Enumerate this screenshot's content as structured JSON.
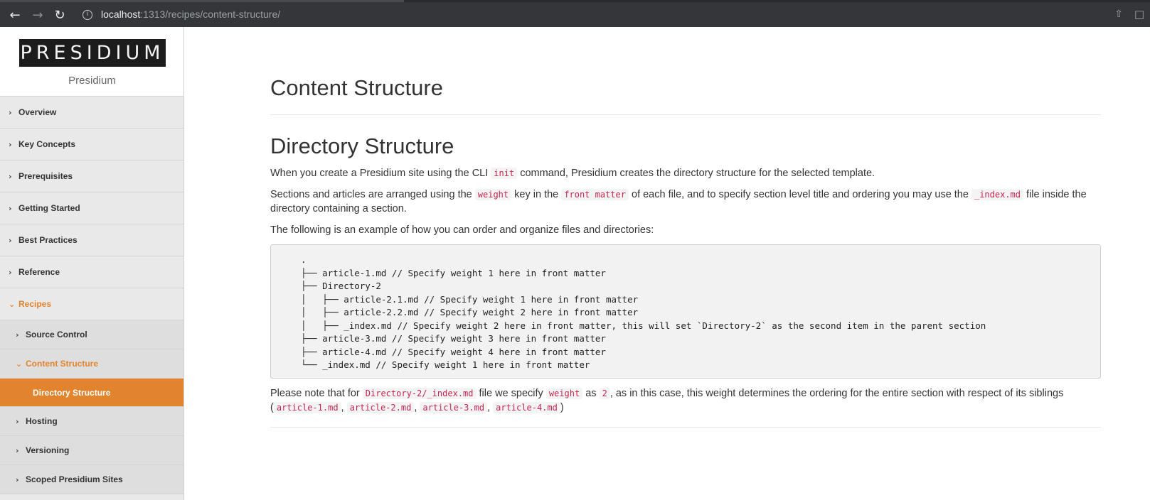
{
  "browser": {
    "url_host": "localhost",
    "url_path": ":1313/recipes/content-structure/",
    "back_icon": "arrow-left-icon",
    "forward_icon": "arrow-right-icon",
    "reload_icon": "reload-icon"
  },
  "sidebar": {
    "logo_text": "PRESIDIUM",
    "site_name": "Presidium",
    "menu": [
      {
        "label": "Overview"
      },
      {
        "label": "Key Concepts"
      },
      {
        "label": "Prerequisites"
      },
      {
        "label": "Getting Started"
      },
      {
        "label": "Best Practices"
      },
      {
        "label": "Reference"
      },
      {
        "label": "Recipes"
      }
    ],
    "submenu": [
      {
        "label": "Source Control"
      },
      {
        "label": "Content Structure"
      },
      {
        "label": "Hosting"
      },
      {
        "label": "Versioning"
      },
      {
        "label": "Scoped Presidium Sites"
      }
    ],
    "leaf": {
      "label": "Directory Structure"
    },
    "accent_color": "#e2832d"
  },
  "main": {
    "page_title": "Content Structure",
    "section_title": "Directory Structure",
    "p1": {
      "t1": "When you create a Presidium site using the CLI",
      "c1": "init",
      "t2": "command, Presidium creates the directory structure for the selected template."
    },
    "p2": {
      "t1": "Sections and articles are arranged using the",
      "c1": "weight",
      "t2": "key in the",
      "c2": "front matter",
      "t3": "of each file, and to specify section level title and ordering you may use the",
      "c3": "_index.md",
      "t4": "file inside the directory containing a section."
    },
    "p3": "The following is an example of how you can order and organize files and directories:",
    "code_lines": [
      ".",
      "├── article-1.md // Specify weight 1 here in front matter",
      "├── Directory-2",
      "│   ├── article-2.1.md // Specify weight 1 here in front matter",
      "│   ├── article-2.2.md // Specify weight 2 here in front matter",
      "│   ├── _index.md // Specify weight 2 here in front matter, this will set `Directory-2` as the second item in the parent section",
      "├── article-3.md // Specify weight 3 here in front matter",
      "├── article-4.md // Specify weight 4 here in front matter",
      "└── _index.md // Specify weight 1 here in front matter"
    ],
    "p4": {
      "t1": "Please note that for",
      "c1": "Directory-2/_index.md",
      "t2": "file we specify",
      "c2": "weight",
      "t3": "as",
      "c3": "2",
      "t4": ", as in this case, this weight determines the ordering for the entire section with respect of its siblings (",
      "c4": "article-1.md",
      "s1": ",",
      "c5": "article-2.md",
      "s2": ",",
      "c6": "article-3.md",
      "s3": ",",
      "c7": "article-4.md",
      "t5": ")"
    }
  }
}
